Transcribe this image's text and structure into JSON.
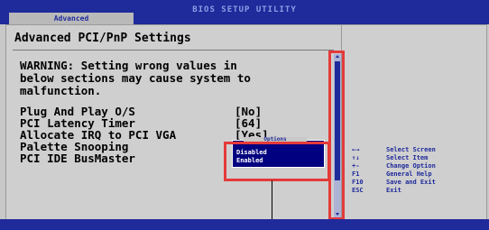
{
  "bios": {
    "title": "BIOS SETUP UTILITY",
    "active_tab": "Advanced",
    "bottom_text": ""
  },
  "panel": {
    "title": "Advanced PCI/PnP Settings",
    "warning": [
      "WARNING: Setting wrong values in",
      "below sections may cause system to",
      "malfunction."
    ]
  },
  "settings": [
    {
      "label": "Plug And Play O/S",
      "value": "[No]"
    },
    {
      "label": "PCI Latency Timer",
      "value": "[64]"
    },
    {
      "label": "Allocate IRQ to PCI VGA",
      "value": "[Yes]"
    },
    {
      "label": "Palette Snooping",
      "value": ""
    },
    {
      "label": "PCI IDE BusMaster",
      "value": ""
    }
  ],
  "popup": {
    "title": "Options",
    "options": [
      "Disabled",
      "Enabled"
    ]
  },
  "help_keys": [
    {
      "key": "←→",
      "action": "Select Screen"
    },
    {
      "key": "↑↓",
      "action": "Select Item"
    },
    {
      "key": "+-",
      "action": "Change Option"
    },
    {
      "key": "F1",
      "action": "General Help"
    },
    {
      "key": "F10",
      "action": "Save and Exit"
    },
    {
      "key": "ESC",
      "action": "Exit"
    }
  ],
  "colors": {
    "bios_blue": "#1f2a9b",
    "panel_gray": "#cfcfcf",
    "highlight_red": "#e53a3a",
    "popup_bg": "#000080"
  }
}
